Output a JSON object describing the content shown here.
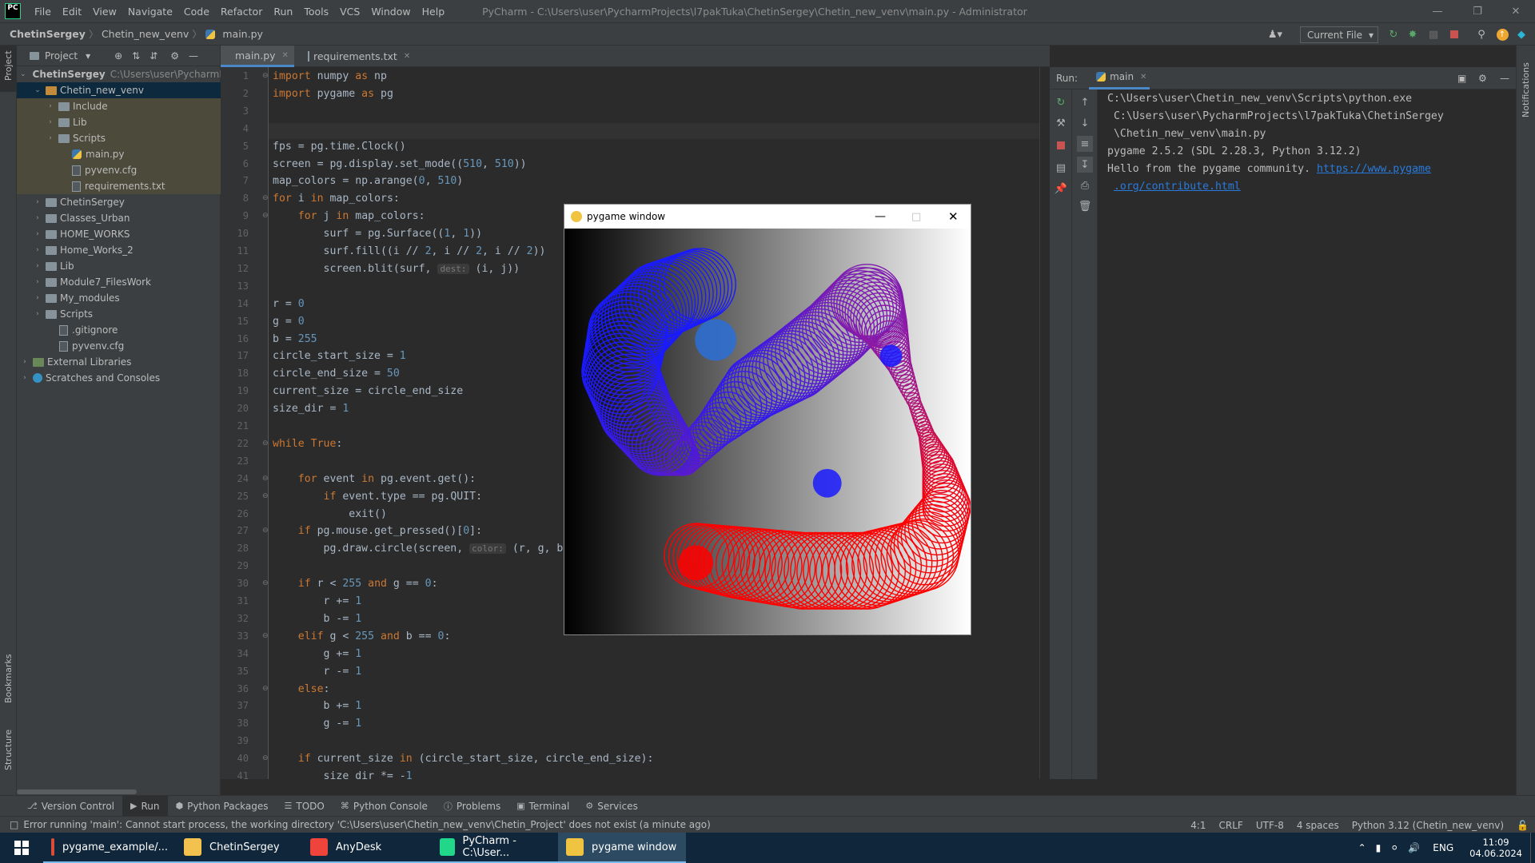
{
  "window": {
    "menu": [
      "File",
      "Edit",
      "View",
      "Navigate",
      "Code",
      "Refactor",
      "Run",
      "Tools",
      "VCS",
      "Window",
      "Help"
    ],
    "title": "PyCharm - C:\\Users\\user\\PycharmProjects\\l7pakTuka\\ChetinSergey\\Chetin_new_venv\\main.py - Administrator"
  },
  "breadcrumbs": [
    "ChetinSergey",
    "Chetin_new_venv",
    "main.py"
  ],
  "toolbar": {
    "run_config": "Current File"
  },
  "stripe": {
    "project": "Project",
    "bookmarks": "Bookmarks",
    "structure": "Structure",
    "notifications": "Notifications"
  },
  "project": {
    "header": "Project",
    "items": [
      {
        "label": "ChetinSergey",
        "extra": "C:\\Users\\user\\PycharmP",
        "depth": 0,
        "type": "folder"
      },
      {
        "label": "Chetin_new_venv",
        "extra": "",
        "depth": 1,
        "type": "folder-orange"
      },
      {
        "label": "Include",
        "extra": "",
        "depth": 2,
        "type": "folder"
      },
      {
        "label": "Lib",
        "extra": "",
        "depth": 2,
        "type": "folder"
      },
      {
        "label": "Scripts",
        "extra": "",
        "depth": 2,
        "type": "folder"
      },
      {
        "label": "main.py",
        "extra": "",
        "depth": 3,
        "type": "py"
      },
      {
        "label": "pyvenv.cfg",
        "extra": "",
        "depth": 3,
        "type": "file"
      },
      {
        "label": "requirements.txt",
        "extra": "",
        "depth": 3,
        "type": "file"
      },
      {
        "label": "ChetinSergey",
        "extra": "",
        "depth": 1,
        "type": "folder"
      },
      {
        "label": "Classes_Urban",
        "extra": "",
        "depth": 1,
        "type": "folder"
      },
      {
        "label": "HOME_WORKS",
        "extra": "",
        "depth": 1,
        "type": "folder"
      },
      {
        "label": "Home_Works_2",
        "extra": "",
        "depth": 1,
        "type": "folder"
      },
      {
        "label": "Lib",
        "extra": "",
        "depth": 1,
        "type": "folder"
      },
      {
        "label": "Module7_FilesWork",
        "extra": "",
        "depth": 1,
        "type": "folder"
      },
      {
        "label": "My_modules",
        "extra": "",
        "depth": 1,
        "type": "folder"
      },
      {
        "label": "Scripts",
        "extra": "",
        "depth": 1,
        "type": "folder"
      },
      {
        "label": ".gitignore",
        "extra": "",
        "depth": 2,
        "type": "file"
      },
      {
        "label": "pyvenv.cfg",
        "extra": "",
        "depth": 2,
        "type": "file"
      },
      {
        "label": "External Libraries",
        "extra": "",
        "depth": 0,
        "type": "lib"
      },
      {
        "label": "Scratches and Consoles",
        "extra": "",
        "depth": 0,
        "type": "scratch"
      }
    ]
  },
  "editor": {
    "tabs": [
      {
        "label": "main.py"
      },
      {
        "label": "requirements.txt"
      }
    ],
    "line_numbers": [
      "1",
      "2",
      "3",
      "4",
      "5",
      "6",
      "7",
      "8",
      "9",
      "10",
      "11",
      "12",
      "13",
      "14",
      "15",
      "16",
      "17",
      "18",
      "19",
      "20",
      "21",
      "22",
      "23",
      "24",
      "25",
      "26",
      "27",
      "28",
      "29",
      "30",
      "31",
      "32",
      "33",
      "34",
      "35",
      "36",
      "37",
      "38",
      "39",
      "40",
      "41"
    ],
    "lines": [
      "[k]import[/] numpy [k]as[/] np",
      "[k]import[/] pygame [k]as[/] pg",
      "",
      "",
      "fps = pg.time.Clock()",
      "screen = pg.display.set_mode(([n]510[/], [n]510[/]))",
      "map_colors = np.arange([n]0[/], [n]510[/])",
      "[k]for[/] i [k]in[/] map_colors:",
      "    [k]for[/] j [k]in[/] map_colors:",
      "        surf = pg.Surface(([n]1[/], [n]1[/]))",
      "        surf.fill((i // [n]2[/], i // [n]2[/], i // [n]2[/]))",
      "        screen.blit(surf, [h]dest:[/] (i, j))",
      "",
      "r = [n]0[/]",
      "g = [n]0[/]",
      "b = [n]255[/]",
      "circle_start_size = [n]1[/]",
      "circle_end_size = [n]50[/]",
      "current_size = circle_end_size",
      "size_dir = [n]1[/]",
      "",
      "[k]while True[/]:",
      "",
      "    [k]for[/] event [k]in[/] pg.event.get():",
      "        [k]if[/] event.type == pg.QUIT:",
      "            exit()",
      "    [k]if[/] pg.mouse.get_pressed()[[n]0[/]]:",
      "        pg.draw.circle(screen, [h]color:[/] (r, g, b)",
      "",
      "    [k]if[/] r < [n]255[/] [k]and[/] g == [n]0[/]:",
      "        r += [n]1[/]",
      "        b -= [n]1[/]",
      "    [k]elif[/] g < [n]255[/] [k]and[/] b == [n]0[/]:",
      "        g += [n]1[/]",
      "        r -= [n]1[/]",
      "    [k]else[/]:",
      "        b += [n]1[/]",
      "        g -= [n]1[/]",
      "",
      "    [k]if[/] current_size [k]in[/] (circle_start_size, circle_end_size):",
      "        size_dir *= -[n]1[/]"
    ]
  },
  "run": {
    "label": "Run:",
    "tab": "main",
    "output": [
      "C:\\Users\\user\\Chetin_new_venv\\Scripts\\python.exe",
      " C:\\Users\\user\\PycharmProjects\\l7pakTuka\\ChetinSergey",
      " \\Chetin_new_venv\\main.py",
      "pygame 2.5.2 (SDL 2.28.3, Python 3.12.2)"
    ],
    "hello": "Hello from the pygame community. ",
    "link1": "https://www.pygame",
    "link2": ".org/contribute.html"
  },
  "pygame_window": {
    "title": "pygame window",
    "colors": {
      "blue": "#1a1aff",
      "purple": "#8a1aa8",
      "red": "#ff0000"
    }
  },
  "bottom_tools": [
    "Version Control",
    "Run",
    "Python Packages",
    "TODO",
    "Python Console",
    "Problems",
    "Terminal",
    "Services"
  ],
  "status": {
    "message": "Error running 'main': Cannot start process, the working directory 'C:\\Users\\user\\Chetin_new_venv\\Chetin_Project' does not exist (a minute ago)",
    "position": "4:1",
    "line_sep": "CRLF",
    "encoding": "UTF-8",
    "indent": "4 spaces",
    "interpreter": "Python 3.12 (Chetin_new_venv)"
  },
  "taskbar": {
    "apps": [
      {
        "label": "pygame_example/...",
        "icon": "chrome-icon",
        "color": "#dd4b39"
      },
      {
        "label": "ChetinSergey",
        "icon": "folder-icon",
        "color": "#f2c14e"
      },
      {
        "label": "AnyDesk",
        "icon": "anydesk-icon",
        "color": "#ef443b"
      },
      {
        "label": "PyCharm - C:\\User...",
        "icon": "pycharm-icon",
        "color": "#21d789"
      },
      {
        "label": "pygame window",
        "icon": "pygame-icon",
        "color": "#f0c440"
      }
    ],
    "lang": "ENG",
    "time": "11:09",
    "date": "04.06.2024"
  }
}
